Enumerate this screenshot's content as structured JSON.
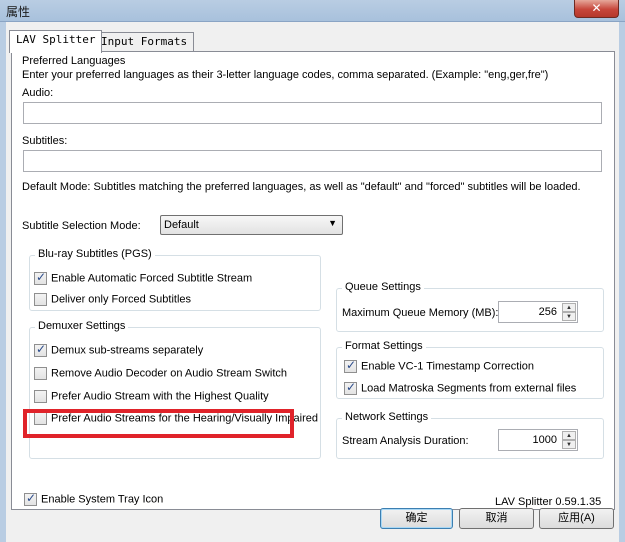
{
  "window": {
    "title": "属性",
    "close_glyph": "✕"
  },
  "tabs": [
    {
      "label": "LAV Splitter",
      "active": true
    },
    {
      "label": "Input Formats",
      "active": false
    }
  ],
  "languages": {
    "header": "Preferred Languages",
    "description": "Enter your preferred languages as their 3-letter language codes, comma separated. (Example: \"eng,ger,fre\")",
    "audio_label": "Audio:",
    "audio_value": "",
    "subtitles_label": "Subtitles:",
    "subtitles_value": "",
    "default_mode_note": "Default Mode: Subtitles matching the preferred languages, as well as \"default\" and \"forced\" subtitles will be loaded."
  },
  "subtitle_mode": {
    "label": "Subtitle Selection Mode:",
    "value": "Default"
  },
  "bluray": {
    "title": "Blu-ray Subtitles (PGS)",
    "options": [
      {
        "label": "Enable Automatic Forced Subtitle Stream",
        "checked": true
      },
      {
        "label": "Deliver only Forced Subtitles",
        "checked": false
      }
    ]
  },
  "demuxer": {
    "title": "Demuxer Settings",
    "options": [
      {
        "label": "Demux sub-streams separately",
        "checked": true
      },
      {
        "label": "Remove Audio Decoder on Audio Stream Switch",
        "checked": false
      },
      {
        "label": "Prefer Audio Stream with the Highest Quality",
        "checked": false
      },
      {
        "label": "Prefer Audio Streams for the Hearing/Visually Impaired",
        "checked": false
      }
    ]
  },
  "queue": {
    "title": "Queue Settings",
    "label": "Maximum Queue Memory (MB):",
    "value": "256"
  },
  "format": {
    "title": "Format Settings",
    "options": [
      {
        "label": "Enable VC-1 Timestamp Correction",
        "checked": true
      },
      {
        "label": "Load Matroska Segments from external files",
        "checked": true
      }
    ]
  },
  "network": {
    "title": "Network Settings",
    "label": "Stream Analysis Duration:",
    "value": "1000"
  },
  "tray": {
    "label": "Enable System Tray Icon",
    "checked": true
  },
  "version": "LAV Splitter 0.59.1.35",
  "buttons": {
    "ok": "确定",
    "cancel": "取消",
    "apply": "应用(A)"
  },
  "colors": {
    "highlight": "#e0232a",
    "titlebar": "#b9cde3",
    "close": "#c7463a"
  }
}
